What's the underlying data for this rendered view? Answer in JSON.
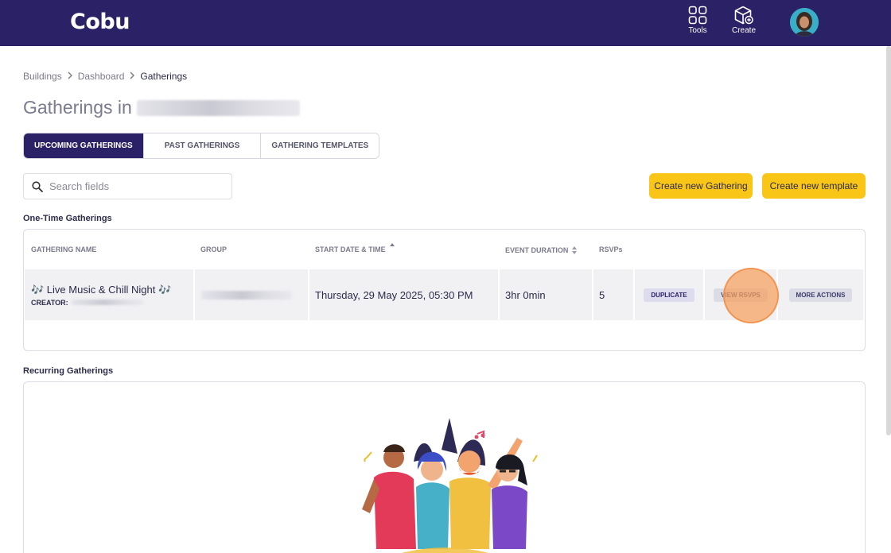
{
  "app": {
    "logo": "Cobu"
  },
  "topnav": {
    "tools_label": "Tools",
    "create_label": "Create"
  },
  "breadcrumb": {
    "items": [
      "Buildings",
      "Dashboard",
      "Gatherings"
    ]
  },
  "page": {
    "title_prefix": "Gatherings in"
  },
  "tabs": [
    {
      "label": "UPCOMING GATHERINGS",
      "active": true
    },
    {
      "label": "PAST GATHERINGS",
      "active": false
    },
    {
      "label": "GATHERING TEMPLATES",
      "active": false
    }
  ],
  "search": {
    "placeholder": "Search fields",
    "value": ""
  },
  "actions": {
    "create_gathering": "Create new Gathering",
    "create_template": "Create new template"
  },
  "one_time": {
    "section_label": "One-Time Gatherings",
    "columns": [
      "GATHERING NAME",
      "GROUP",
      "START DATE & TIME",
      "EVENT DURATION",
      "RSVPs"
    ],
    "rows": [
      {
        "name": "🎶 Live Music & Chill Night 🎶",
        "creator_label": "CREATOR:",
        "start": "Thursday, 29 May 2025, 05:30 PM",
        "duration": "3hr 0min",
        "rsvps": "5",
        "duplicate": "DUPLICATE",
        "view_rsvps": "VIEW RSVPS",
        "more_actions": "MORE ACTIONS"
      }
    ]
  },
  "recurring": {
    "section_label": "Recurring Gatherings"
  },
  "colors": {
    "brand": "#2b2166",
    "accent": "#f9c516"
  }
}
